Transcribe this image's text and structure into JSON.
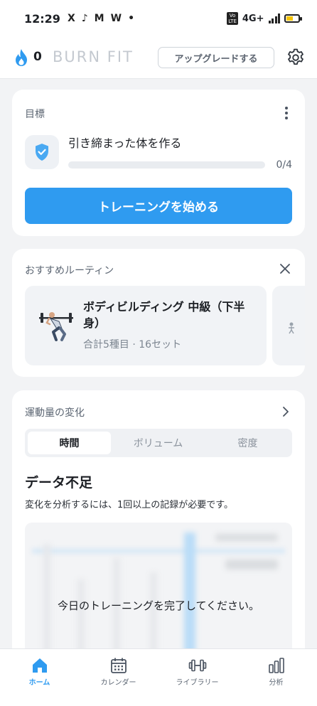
{
  "status_bar": {
    "time": "12:29",
    "app_icons": [
      "X",
      "♪",
      "M",
      "W",
      "•"
    ],
    "volte": "Vo\nLTE",
    "network": "4G+",
    "battery_level": 0.55
  },
  "header": {
    "streak_count": "0",
    "brand": "BURN FIT",
    "upgrade_label": "アップグレードする"
  },
  "goal_card": {
    "title": "目標",
    "goal_name": "引き締まった体を作る",
    "progress_text": "0/4",
    "progress_fraction": 0,
    "start_button": "トレーニングを始める"
  },
  "routine_card": {
    "title": "おすすめルーティン",
    "routine_name": "ボディビルディング 中級（下半身）",
    "routine_meta": "合計5種目 · 16セット"
  },
  "volume_card": {
    "title": "運動量の変化",
    "tabs": [
      "時間",
      "ボリューム",
      "密度"
    ],
    "active_tab": "時間",
    "no_data_title": "データ不足",
    "no_data_desc": "変化を分析するには、1回以上の記録が必要です。",
    "chart_message": "今日のトレーニングを完了してください。"
  },
  "bottom_nav": {
    "items": [
      {
        "label": "ホーム",
        "icon": "home-icon",
        "active": true
      },
      {
        "label": "カレンダー",
        "icon": "calendar-icon",
        "active": false
      },
      {
        "label": "ライブラリー",
        "icon": "dumbbell-icon",
        "active": false
      },
      {
        "label": "分析",
        "icon": "bar-chart-icon",
        "active": false
      }
    ]
  },
  "colors": {
    "accent": "#2f9bf0",
    "background": "#f2f3f5",
    "card": "#ffffff"
  }
}
